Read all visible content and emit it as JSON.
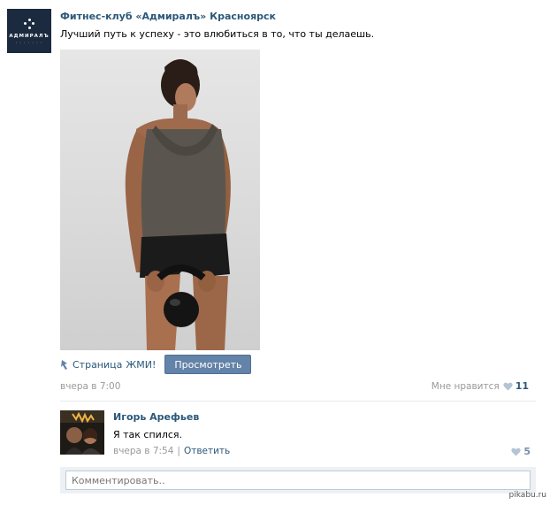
{
  "post": {
    "author": "Фитнес-клуб «Адмиралъ» Красноярск",
    "logo_text": "АДМИРАЛЪ",
    "text": "Лучший путь к успеху - это влюбиться в то, что ты делаешь.",
    "app_prefix": "Страница",
    "app_name": "ЖМИ!",
    "view_button": "Просмотреть",
    "time": "вчера в 7:00",
    "like_label": "Мне нравится",
    "like_count": "11"
  },
  "comment": {
    "author": "Игорь Арефьев",
    "text": "Я так спился.",
    "time": "вчера в 7:54",
    "separator": "|",
    "reply": "Ответить",
    "like_count": "5"
  },
  "comment_input": {
    "placeholder": "Комментировать.."
  },
  "watermark": "pikabu.ru",
  "colors": {
    "link": "#2b587a",
    "button": "#6383a8",
    "muted": "#999999"
  }
}
